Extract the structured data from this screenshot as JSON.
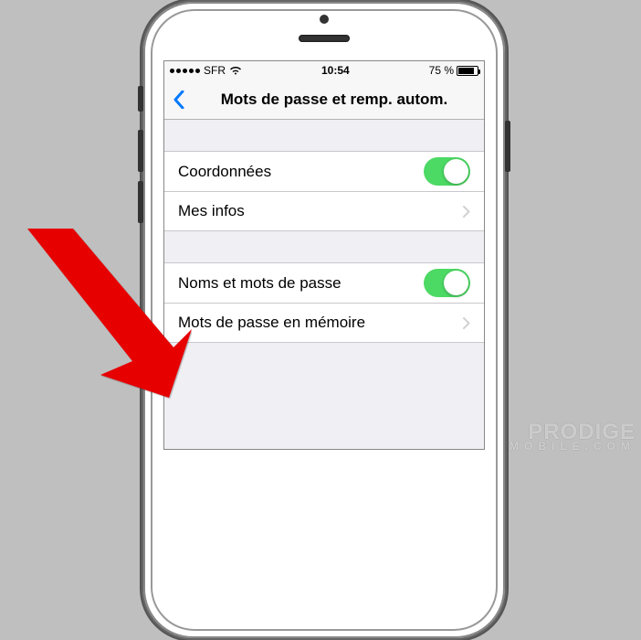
{
  "status": {
    "carrier": "SFR",
    "time": "10:54",
    "battery_pct": "75 %"
  },
  "nav": {
    "title": "Mots de passe et remp. autom."
  },
  "rows": {
    "coords": {
      "label": "Coordonnées"
    },
    "myinfo": {
      "label": "Mes infos"
    },
    "names_pw": {
      "label": "Noms et mots de passe"
    },
    "saved_pw": {
      "label": "Mots de passe en mémoire"
    }
  },
  "watermark": {
    "line1": "PRODIGE",
    "line2": "MOBILE.COM"
  }
}
